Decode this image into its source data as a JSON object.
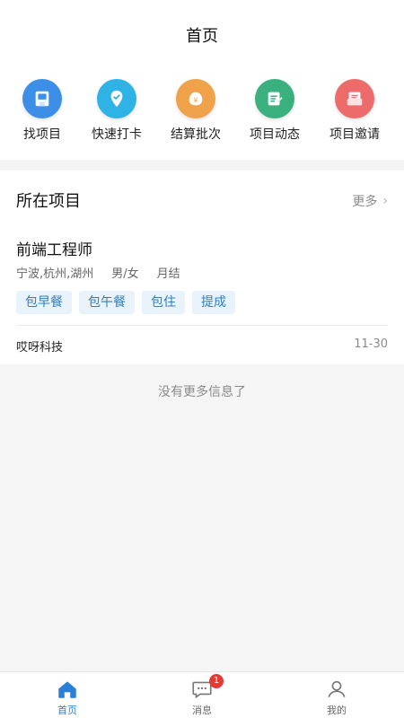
{
  "header": {
    "title": "首页"
  },
  "quick_actions": [
    {
      "label": "找项目",
      "icon": "find-project-icon",
      "color": "#3d8ee6"
    },
    {
      "label": "快速打卡",
      "icon": "quick-checkin-icon",
      "color": "#2fb3e6"
    },
    {
      "label": "结算批次",
      "icon": "settlement-icon",
      "color": "#f0a24a"
    },
    {
      "label": "项目动态",
      "icon": "project-news-icon",
      "color": "#39b07e"
    },
    {
      "label": "项目邀请",
      "icon": "project-invite-icon",
      "color": "#ee6b6b"
    }
  ],
  "section": {
    "title": "所在项目",
    "more_label": "更多"
  },
  "project": {
    "title": "前端工程师",
    "locations": "宁波,杭州,湖州",
    "gender": "男/女",
    "settlement": "月结",
    "tags": [
      "包早餐",
      "包午餐",
      "包住",
      "提成"
    ],
    "company": "哎呀科技",
    "date": "11-30"
  },
  "no_more_text": "没有更多信息了",
  "tabbar": {
    "tabs": [
      {
        "label": "首页",
        "icon": "home-icon",
        "active": true
      },
      {
        "label": "消息",
        "icon": "message-icon",
        "badge": "1"
      },
      {
        "label": "我的",
        "icon": "profile-icon"
      }
    ],
    "accent": "#2a7fd8",
    "badge_color": "#e53935"
  }
}
